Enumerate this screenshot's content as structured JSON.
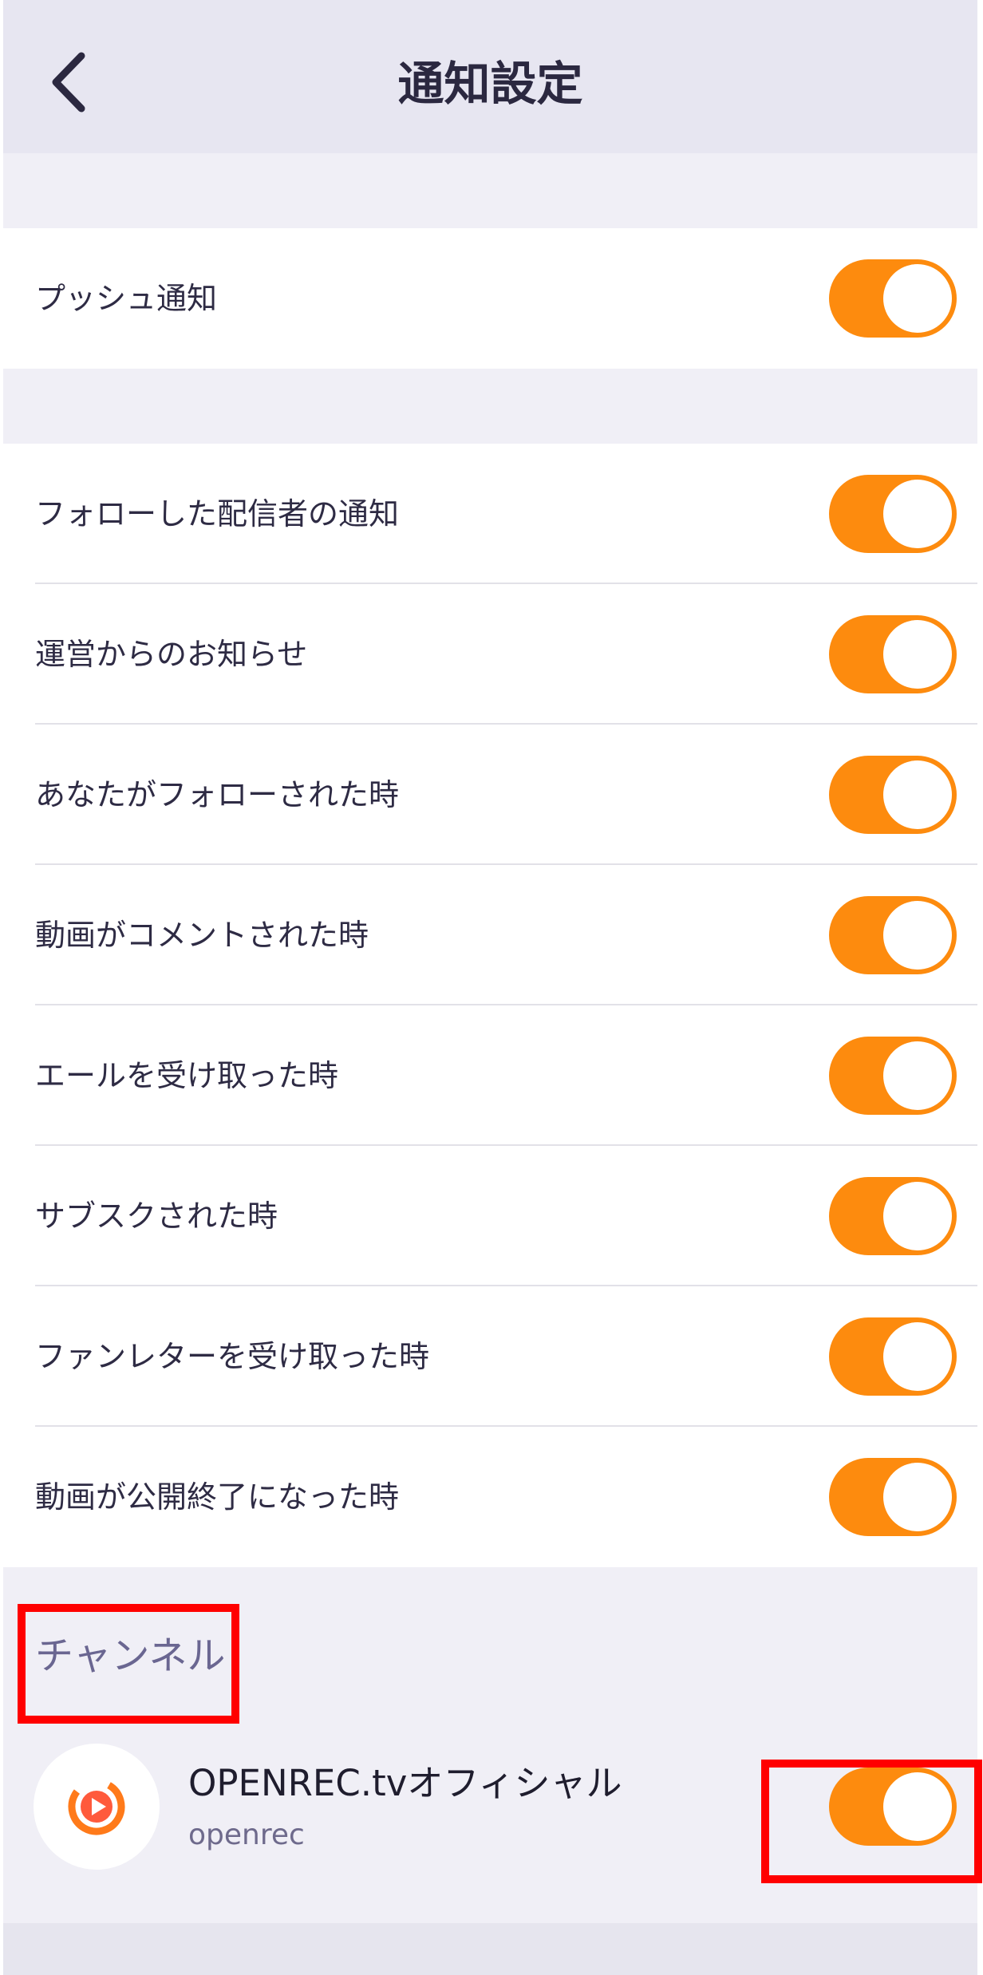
{
  "header": {
    "title": "通知設定",
    "back_icon": "chevron-left-icon"
  },
  "push_section": {
    "items": [
      {
        "label": "プッシュ通知",
        "on": true
      }
    ]
  },
  "notification_section": {
    "items": [
      {
        "label": "フォローした配信者の通知",
        "on": true
      },
      {
        "label": "運営からのお知らせ",
        "on": true
      },
      {
        "label": "あなたがフォローされた時",
        "on": true
      },
      {
        "label": "動画がコメントされた時",
        "on": true
      },
      {
        "label": "エールを受け取った時",
        "on": true
      },
      {
        "label": "サブスクされた時",
        "on": true
      },
      {
        "label": "ファンレターを受け取った時",
        "on": true
      },
      {
        "label": "動画が公開終了になった時",
        "on": true
      }
    ]
  },
  "channel_section": {
    "heading": "チャンネル",
    "channel": {
      "name": "OPENREC.tvオフィシャル",
      "id": "openrec",
      "on": true
    }
  },
  "colors": {
    "accent": "#fd8b0e",
    "highlight": "#ff0000",
    "header_bg": "#e7e6f1",
    "page_bg": "#f0eff6"
  }
}
